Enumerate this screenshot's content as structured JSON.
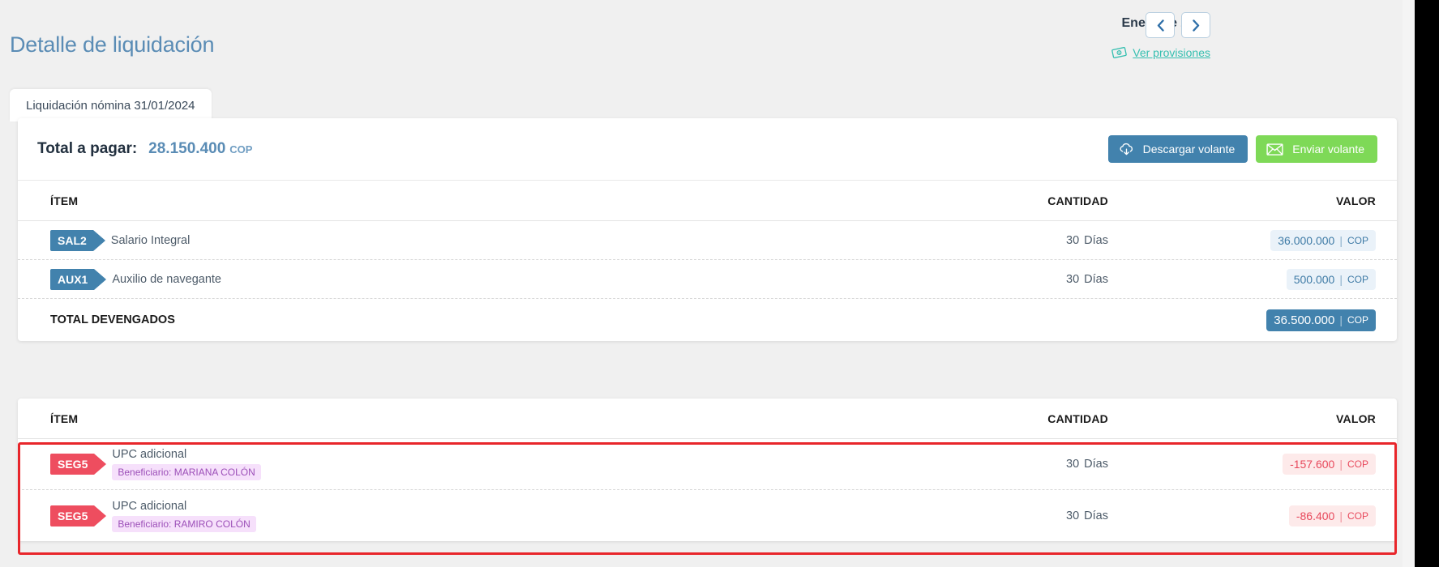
{
  "header": {
    "title": "Detalle de liquidación",
    "period": "Enero de 2024",
    "prev_button": "‹",
    "next_button": "›",
    "provisions_link": "Ver provisiones",
    "provisions_icon": "banknote-icon"
  },
  "tab": {
    "label": "Liquidación nómina 31/01/2024"
  },
  "summary": {
    "total_label": "Total a pagar:",
    "total_amount": "28.150.400",
    "currency": "COP",
    "download_button": "Descargar volante",
    "download_icon": "cloud-download-icon",
    "send_button": "Enviar volante",
    "send_icon": "envelope-icon"
  },
  "table_headers": {
    "item": "ÍTEM",
    "quantity": "CANTIDAD",
    "value": "VALOR"
  },
  "earnings": {
    "rows": [
      {
        "code": "SAL2",
        "name": "Salario Integral",
        "qty": "30",
        "qty_unit": "Días",
        "amount": "36.000.000",
        "currency": "COP"
      },
      {
        "code": "AUX1",
        "name": "Auxilio de navegante",
        "qty": "30",
        "qty_unit": "Días",
        "amount": "500.000",
        "currency": "COP"
      }
    ],
    "total_label": "TOTAL DEVENGADOS",
    "total_amount": "36.500.000",
    "total_currency": "COP"
  },
  "deductions": {
    "rows": [
      {
        "code": "SEG5",
        "name": "UPC adicional",
        "beneficiary": "Beneficiario: MARIANA COLÓN",
        "qty": "30",
        "qty_unit": "Días",
        "amount": "-157.600",
        "currency": "COP"
      },
      {
        "code": "SEG5",
        "name": "UPC adicional",
        "beneficiary": "Beneficiario: RAMIRO COLÓN",
        "qty": "30",
        "qty_unit": "Días",
        "amount": "-86.400",
        "currency": "COP"
      }
    ]
  },
  "colors": {
    "title_blue": "#5a8cb5",
    "accent_blue": "#4282ad",
    "accent_green": "#7ed957",
    "accent_teal": "#35bfb0",
    "accent_red": "#ee4d5f",
    "highlight_red": "#e8262b",
    "beneficiary_purple": "#9c4fb8"
  }
}
